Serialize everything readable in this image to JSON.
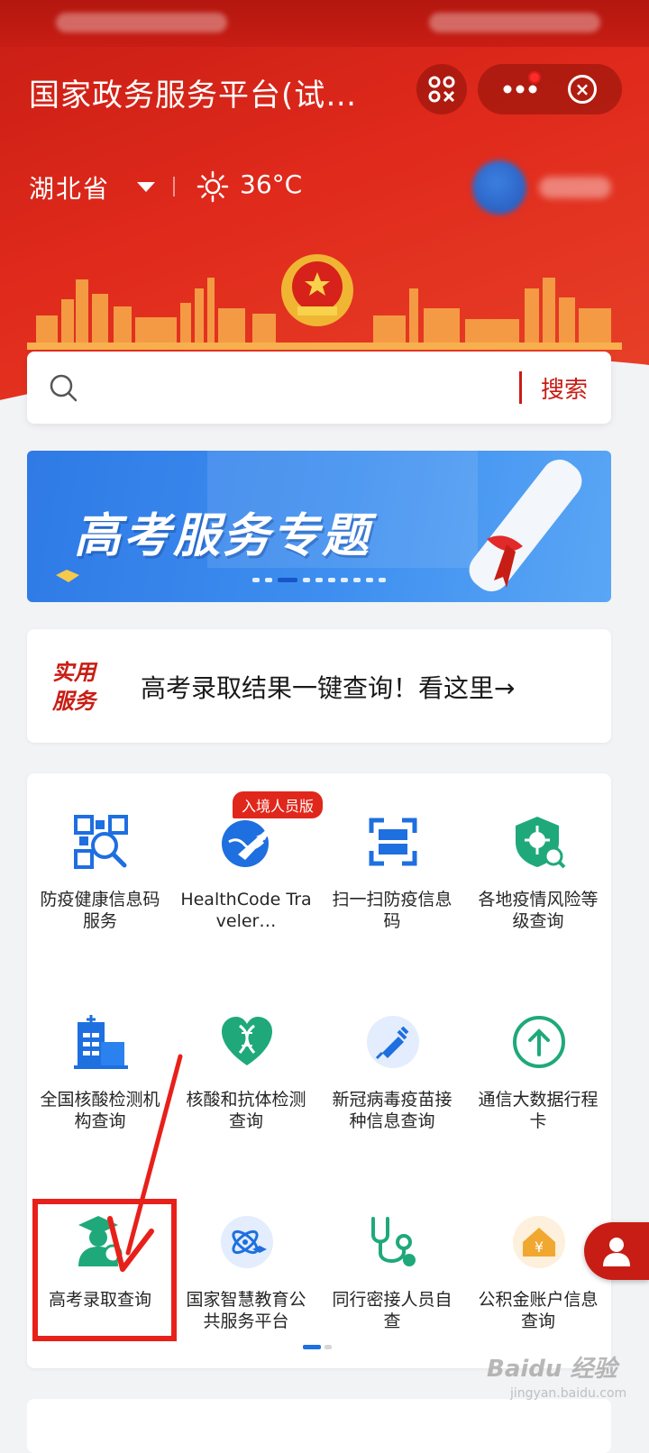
{
  "header": {
    "title": "国家政务服务平台(试…",
    "province": "湖北省",
    "temperature": "36°C"
  },
  "search": {
    "button_label": "搜索"
  },
  "banner": {
    "title": "高考服务专题"
  },
  "practical_service": {
    "badge_line1": "实用",
    "badge_line2": "服务",
    "text": "高考录取结果一键查询！看这里→"
  },
  "services": [
    {
      "label": "防疫健康信息码服务",
      "icon": "qr-search-icon",
      "tag": ""
    },
    {
      "label": "HealthCode Traveler…",
      "icon": "globe-plane-icon",
      "tag": "入境人员版"
    },
    {
      "label": "扫一扫防疫信息码",
      "icon": "scan-icon",
      "tag": ""
    },
    {
      "label": "各地疫情风险等级查询",
      "icon": "virus-shield-icon",
      "tag": ""
    },
    {
      "label": "全国核酸检测机构查询",
      "icon": "hospital-icon",
      "tag": ""
    },
    {
      "label": "核酸和抗体检测查询",
      "icon": "dna-heart-icon",
      "tag": ""
    },
    {
      "label": "新冠病毒疫苗接种信息查询",
      "icon": "vaccine-icon",
      "tag": ""
    },
    {
      "label": "通信大数据行程卡",
      "icon": "arrow-up-circle-icon",
      "tag": ""
    },
    {
      "label": "高考录取查询",
      "icon": "graduate-search-icon",
      "tag": ""
    },
    {
      "label": "国家智慧教育公共服务平台",
      "icon": "education-atom-icon",
      "tag": ""
    },
    {
      "label": "同行密接人员自查",
      "icon": "stethoscope-icon",
      "tag": ""
    },
    {
      "label": "公积金账户信息查询",
      "icon": "yuan-house-icon",
      "tag": ""
    }
  ],
  "watermark": {
    "brand": "Baidu 经验",
    "url": "jingyan.baidu.com"
  },
  "colors": {
    "brand_red": "#c81d14",
    "accent_blue": "#1e6fe0",
    "highlight_red": "#e8201a"
  }
}
